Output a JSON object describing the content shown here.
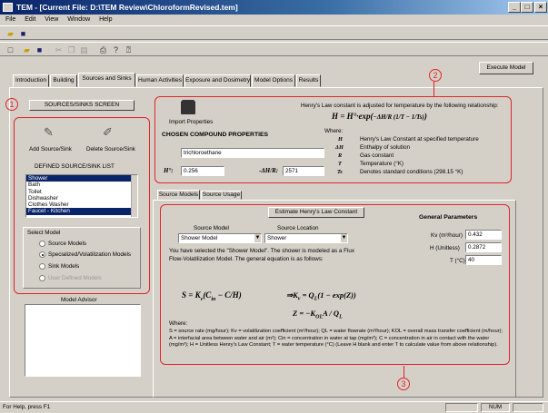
{
  "window": {
    "title": "TEM - [Current File: D:\\TEM Review\\ChloroformRevised.tem]"
  },
  "menu": [
    "File",
    "Edit",
    "View",
    "Window",
    "Help"
  ],
  "tabs": [
    "Introduction",
    "Building",
    "Sources and Sinks",
    "Human Activities",
    "Exposure and Dosimetry",
    "Model Options",
    "Results"
  ],
  "execute_label": "Execute Model",
  "left": {
    "screen_button": "SOURCES/SINKS SCREEN",
    "add_label": "Add Source/Sink",
    "delete_label": "Delete Source/Sink",
    "list_title": "DEFINED SOURCE/SINK LIST",
    "list_items": [
      "Shower",
      "Bath",
      "Toilet",
      "Dishwasher",
      "Clothes Washer",
      "Faucet - Kitchen"
    ],
    "select_model_title": "Select Model",
    "models": [
      "Source Models",
      "Specialized/Volatilization Models",
      "Sink Models",
      "User Defined Models"
    ],
    "model_advisor": "Model Advisor"
  },
  "chem": {
    "import_label": "Import Properties",
    "title": "CHOSEN COMPOUND PROPERTIES",
    "name": "trichloroethane",
    "h0_label": "H°:",
    "h0_value": "0.256",
    "dh_label": "-ΔH/R:",
    "dh_value": "2571",
    "henry_text": "Henry's Law constant is adjusted for temperature by the following relationship:",
    "where": "Where:",
    "defs": [
      {
        "sym": "H",
        "text": "Henry's Law Constant at specified temperature"
      },
      {
        "sym": "ΔH",
        "text": "Enthalpy of solution"
      },
      {
        "sym": "R",
        "text": "Gas constant"
      },
      {
        "sym": "T",
        "text": "Temperature (°K)"
      },
      {
        "sym": "Ts",
        "text": "Denotes standard conditions (298.15 °K)"
      }
    ]
  },
  "source": {
    "tabs": [
      "Source Models",
      "Source Usage"
    ],
    "estimate_button": "Estimate Henry's Law Constant",
    "model_label": "Source Model",
    "location_label": "Source Location",
    "model_value": "Shower Model",
    "location_value": "Shower",
    "description": "You have selected the \"Shower Model\". The shower is modeled as a Flux Flow-Volatilization Model. The general equation is as follows:",
    "general_params": "General Parameters",
    "params": [
      {
        "label": "Kv (m³/hour)",
        "value": "0.432"
      },
      {
        "label": "H (Unitless)",
        "value": "0.2872"
      },
      {
        "label": "T (°C)",
        "value": "40"
      }
    ],
    "where": "Where:",
    "legend": "S = source rate (mg/hour);   Kv = volatilization coefficient (m³/hour);   QL = water flowrate (m³/hour);   KOL = overall mass transfer coefficient (m/hour);   A = interfacial area between water and air (m²);   Cin = concentration in water at tap (mg/m³); C = concentration in air in contact with the water (mg/m³);   H = Unitless Henry's Law Constant;   T = water temperature (°C) (Leave H blank and enter T to calculate value from above relationship)."
  },
  "status": {
    "help": "For Help, press F1",
    "num": "NUM"
  },
  "annotations": [
    "1",
    "2",
    "3"
  ]
}
